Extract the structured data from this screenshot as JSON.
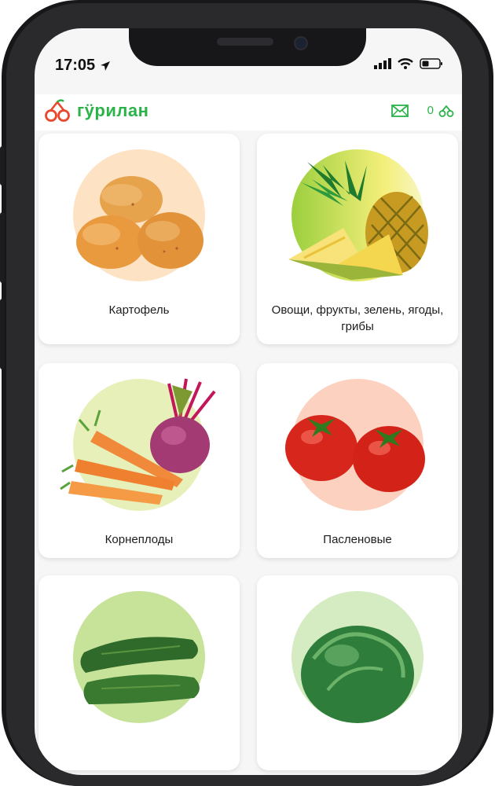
{
  "status_bar": {
    "time": "17:05"
  },
  "header": {
    "brand": "гӱрилан",
    "cart_count": "0"
  },
  "categories": [
    {
      "label": "Картофель",
      "image": "potatoes",
      "bg": "#fde2c4"
    },
    {
      "label": "Овощи, фрукты, зелень, ягоды, грибы",
      "image": "pineapple",
      "bg": "#f4ef7a"
    },
    {
      "label": "Корнеплоды",
      "image": "carrots-and-beet",
      "bg": "#e7f0b8"
    },
    {
      "label": "Пасленовые",
      "image": "tomatoes",
      "bg": "#fcd1c0"
    },
    {
      "label": "",
      "image": "cucumbers",
      "bg": "#c7e39a"
    },
    {
      "label": "",
      "image": "cabbage",
      "bg": "#d5ebc2"
    }
  ],
  "colors": {
    "brand_green": "#2bb34a",
    "logo_red": "#e8492e"
  }
}
